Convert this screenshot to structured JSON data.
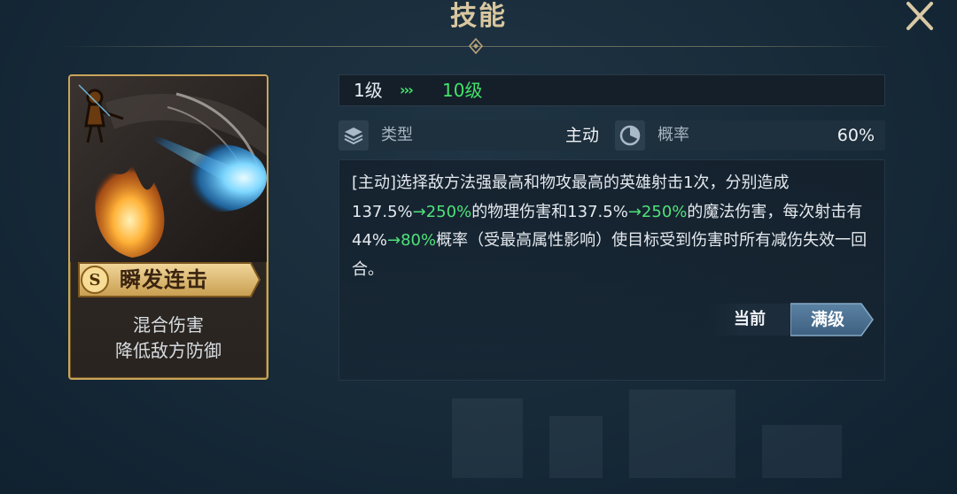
{
  "header": {
    "title": "技能"
  },
  "card": {
    "rank": "S",
    "skill_name": "瞬发连击",
    "desc_line1": "混合伤害",
    "desc_line2": "降低敌方防御"
  },
  "level": {
    "from": "1级",
    "arrows": "›››",
    "to": "10级"
  },
  "stats": {
    "type_label": "类型",
    "type_value": "主动",
    "chance_label": "概率",
    "chance_value": "60%"
  },
  "description": {
    "seg1": "[主动]选择敌方法强最高和物攻最高的英雄射击1次，分别造成137.5%",
    "seg2": "→250%",
    "seg3": "的物理伤害和137.5%",
    "seg4": "→250%",
    "seg5": "的魔法伤害，每次射击有44%",
    "seg6": "→80%",
    "seg7": "概率（受最高属性影响）使目标受到伤害时所有减伤失效一回合。"
  },
  "tabs": {
    "current": "当前",
    "max": "满级"
  },
  "colors": {
    "accent_green": "#43e36a",
    "gold": "#c9a55a",
    "tab_blue": "#4f7392"
  }
}
